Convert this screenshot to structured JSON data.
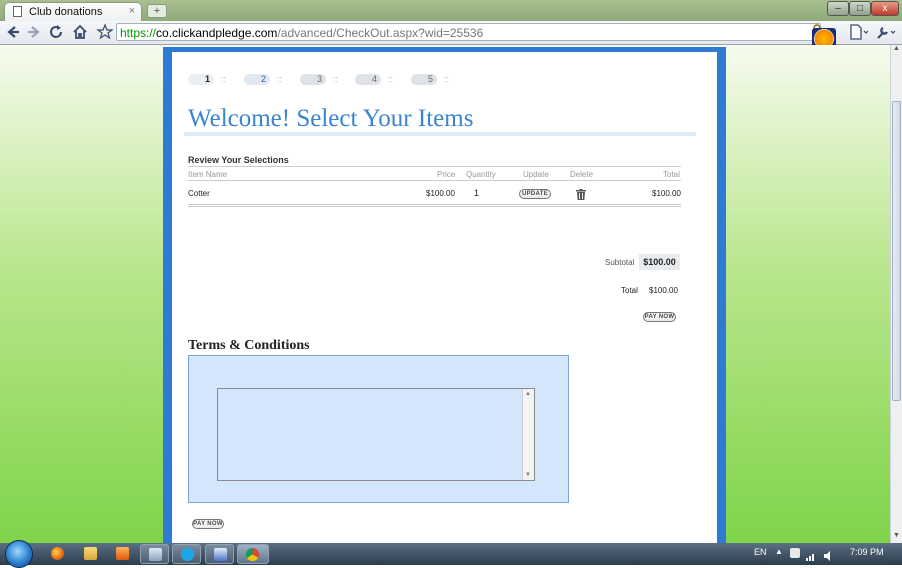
{
  "browser": {
    "tab_title": "Club donations",
    "tab_close": "×",
    "new_tab": "+",
    "window_controls": {
      "minimize": "–",
      "maximize": "□",
      "close": "x"
    },
    "url": {
      "scheme": "https://",
      "host": "co.clickandpledge.com",
      "path": "/advanced/CheckOut.aspx?wid=25536"
    }
  },
  "steps": [
    "1",
    "2",
    "3",
    "4",
    "5"
  ],
  "step_separator": "::",
  "heading": "Welcome! Select Your Items",
  "review": {
    "title": "Review Your Selections",
    "columns": [
      "Item Name",
      "Price",
      "Quantity",
      "Update",
      "Delete",
      "Total"
    ],
    "rows": [
      {
        "name": "Cotter",
        "price": "$100.00",
        "quantity": "1",
        "update_label": "UPDATE",
        "total": "$100.00"
      }
    ],
    "subtotal_label": "Subtotal",
    "subtotal_value": "$100.00",
    "total_label": "Total",
    "total_value": "$100.00",
    "pay_now_label": "PAY NOW"
  },
  "terms": {
    "title": "Terms & Conditions",
    "text": ""
  },
  "footer_pay_now_label": "PAY NOW",
  "taskbar": {
    "language": "EN",
    "tray_arrow": "▲",
    "clock": "7:09 PM"
  },
  "colors": {
    "panel_border": "#2e7bd6",
    "heading": "#3a85cf",
    "terms_background": "#d3e6fb",
    "https_green": "#009a00"
  }
}
